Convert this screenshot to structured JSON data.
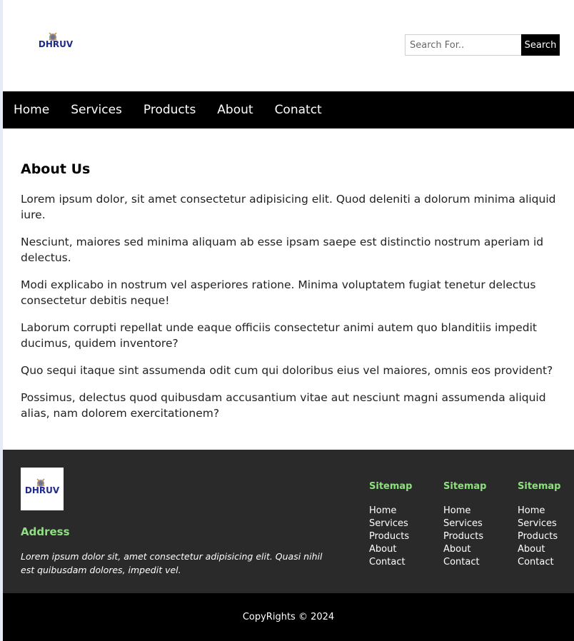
{
  "header": {
    "logo_text": "DHRUV",
    "search": {
      "placeholder": "Search For..",
      "button_label": "Search"
    }
  },
  "nav": {
    "items": [
      {
        "label": "Home"
      },
      {
        "label": "Services"
      },
      {
        "label": "Products"
      },
      {
        "label": "About"
      },
      {
        "label": "Conatct"
      }
    ]
  },
  "main": {
    "title": "About Us",
    "paragraphs": [
      "Lorem ipsum dolor, sit amet consectetur adipisicing elit. Quod deleniti a dolorum minima aliquid iure.",
      "Nesciunt, maiores sed minima aliquam ab esse ipsam saepe est distinctio nostrum aperiam id delectus.",
      "Modi explicabo in nostrum vel asperiores ratione. Minima voluptatem fugiat tenetur delectus consectetur debitis neque!",
      "Laborum corrupti repellat unde eaque officiis consectetur animi autem quo blanditiis impedit ducimus, quidem inventore?",
      "Quo sequi itaque sint assumenda odit cum qui doloribus eius vel maiores, omnis eos provident?",
      "Possimus, delectus quod quibusdam accusantium vitae aut nesciunt magni assumenda aliquid alias, nam dolorem exercitationem?"
    ]
  },
  "footer": {
    "logo_text": "DHRUV",
    "address_title": "Address",
    "address_text": "Lorem ipsum dolor sit, amet consectetur adipisicing elit. Quasi nihil est quibusdam dolores, impedit vel.",
    "sitemaps": [
      {
        "title": "Sitemap",
        "links": [
          "Home",
          "Services",
          "Products",
          "About",
          "Contact"
        ]
      },
      {
        "title": "Sitemap",
        "links": [
          "Home",
          "Services",
          "Products",
          "About",
          "Contact"
        ]
      },
      {
        "title": "Sitemap",
        "links": [
          "Home",
          "Services",
          "Products",
          "About",
          "Contact"
        ]
      }
    ],
    "copyright": "CopyRights © 2024"
  },
  "colors": {
    "nav_bg": "#000000",
    "footer_bg": "#2a2a2a",
    "footer_accent": "#8fe07f",
    "logo_blue": "#1f2a8c"
  }
}
